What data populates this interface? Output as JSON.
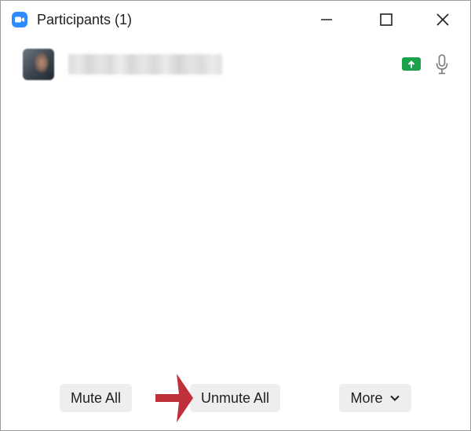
{
  "window": {
    "title": "Participants (1)",
    "icons": {
      "app": "zoom-camera-icon",
      "minimize": "minimize-icon",
      "maximize": "maximize-icon",
      "close": "close-icon"
    }
  },
  "participants": [
    {
      "name": "",
      "avatar": "avatar-photo",
      "status_icons": [
        "screen-share-icon",
        "microphone-icon"
      ]
    }
  ],
  "footer": {
    "mute_all_label": "Mute All",
    "unmute_all_label": "Unmute All",
    "more_label": "More"
  },
  "annotation": {
    "icon": "red-arrow-icon",
    "color": "#c0303a"
  },
  "colors": {
    "zoom_blue": "#2d8cff",
    "share_green": "#1aa34a",
    "button_bg": "#eeeeee"
  }
}
